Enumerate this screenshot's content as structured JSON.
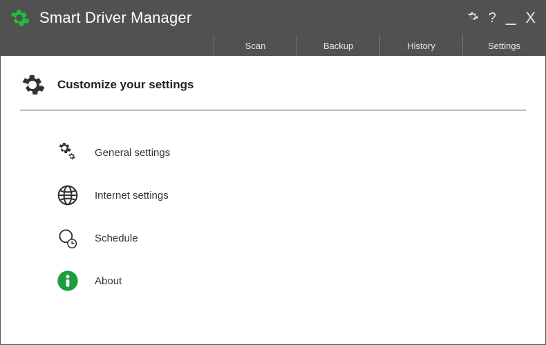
{
  "app": {
    "title": "Smart Driver Manager"
  },
  "tabs": [
    {
      "label": "Scan"
    },
    {
      "label": "Backup"
    },
    {
      "label": "History"
    },
    {
      "label": "Settings",
      "active": true
    }
  ],
  "page": {
    "title": "Customize your settings"
  },
  "options": [
    {
      "label": "General settings",
      "icon": "gears"
    },
    {
      "label": "Internet settings",
      "icon": "globe"
    },
    {
      "label": "Schedule",
      "icon": "schedule"
    },
    {
      "label": "About",
      "icon": "about"
    }
  ],
  "colors": {
    "accent": "#1b9e3e",
    "header_bg": "#515151"
  }
}
